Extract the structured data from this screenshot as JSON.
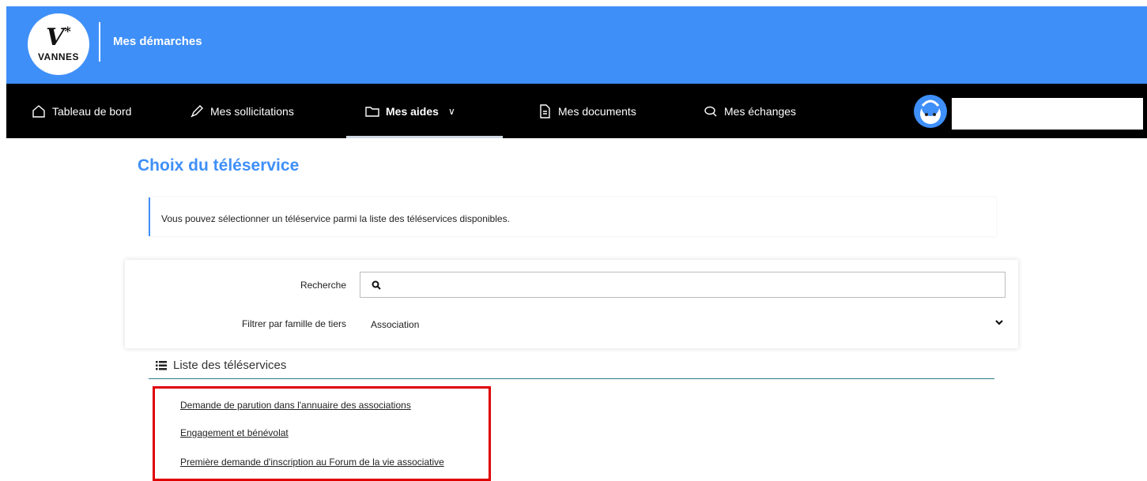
{
  "header": {
    "logo_text": "VANNES",
    "app_title": "Mes démarches",
    "brand_color": "#3f8ff8"
  },
  "nav": {
    "items": [
      {
        "label": "Tableau de bord",
        "icon": "home-icon"
      },
      {
        "label": "Mes sollicitations",
        "icon": "pen-icon"
      },
      {
        "label": "Mes aides",
        "icon": "folder-icon",
        "active": true
      },
      {
        "label": "Mes documents",
        "icon": "document-icon"
      },
      {
        "label": "Mes échanges",
        "icon": "chat-icon"
      }
    ],
    "username": ""
  },
  "main": {
    "title": "Choix du téléservice",
    "info": "Vous pouvez sélectionner un téléservice parmi la liste des téléservices disponibles.",
    "search": {
      "label": "Recherche",
      "value": "",
      "placeholder": ""
    },
    "filter": {
      "label": "Filtrer par famille de tiers",
      "selected": "Association"
    },
    "list": {
      "title": "Liste des téléservices",
      "items": [
        "Demande de parution dans l'annuaire des associations",
        "Engagement et bénévolat",
        "Première demande d'inscription au Forum de la vie associative"
      ]
    }
  }
}
